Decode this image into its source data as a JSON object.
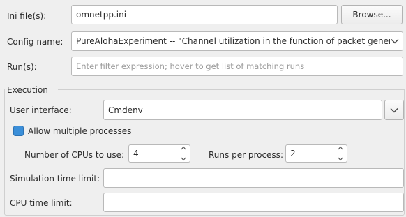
{
  "ini_files": {
    "label": "Ini file(s):",
    "value": "omnetpp.ini",
    "browse_label": "Browse..."
  },
  "config": {
    "label": "Config name:",
    "value": "PureAlohaExperiment -- \"Channel utilization in the function of packet gener"
  },
  "runs": {
    "label": "Run(s):",
    "placeholder": "Enter filter expression; hover to get list of matching runs"
  },
  "execution": {
    "group_title": "Execution",
    "user_interface_label": "User interface:",
    "user_interface_value": "Cmdenv",
    "allow_multiple_label": "Allow multiple processes",
    "allow_multiple_checked": true,
    "cpus_label": "Number of CPUs to use:",
    "cpus_value": "4",
    "runs_per_process_label": "Runs per process:",
    "runs_per_process_value": "2",
    "sim_time_limit_label": "Simulation time limit:",
    "sim_time_limit_value": "",
    "cpu_time_limit_label": "CPU time limit:",
    "cpu_time_limit_value": ""
  },
  "icons": {
    "dropdown": "chevron-down-icon",
    "spin_up": "chevron-up-icon",
    "spin_down": "chevron-down-icon",
    "checkbox": "checkbox-icon"
  },
  "colors": {
    "accent": "#3b8fd9",
    "background": "#efefef",
    "field": "#ffffff",
    "border": "#b9b9b9"
  }
}
